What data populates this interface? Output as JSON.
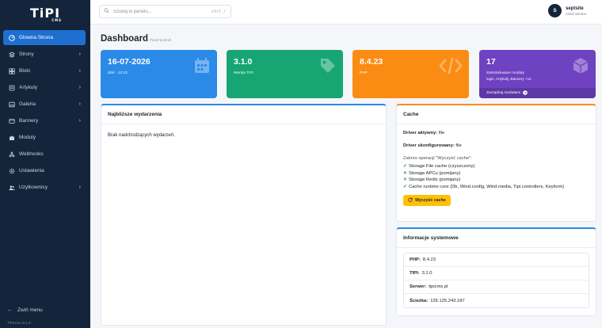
{
  "brand": {
    "logo": "TiPI",
    "logo_sub": "CMS",
    "version": "TiPIcms v3.1.0"
  },
  "sidebar": {
    "items": [
      {
        "label": "Glowna Strona",
        "icon": "dashboard-icon",
        "active": true,
        "chevron": false
      },
      {
        "label": "Strony",
        "icon": "layers-icon",
        "active": false,
        "chevron": true
      },
      {
        "label": "Bloki",
        "icon": "blocks-icon",
        "active": false,
        "chevron": true
      },
      {
        "label": "Artykuly",
        "icon": "article-icon",
        "active": false,
        "chevron": true
      },
      {
        "label": "Galeria",
        "icon": "image-icon",
        "active": false,
        "chevron": true
      },
      {
        "label": "Bannery",
        "icon": "banner-icon",
        "active": false,
        "chevron": true
      },
      {
        "label": "Moduly",
        "icon": "puzzle-icon",
        "active": false,
        "chevron": false
      },
      {
        "label": "Webhooks",
        "icon": "webhook-icon",
        "active": false,
        "chevron": false
      },
      {
        "label": "Ustawienia",
        "icon": "gear-icon",
        "active": false,
        "chevron": false
      },
      {
        "label": "Uzytkownicy",
        "icon": "users-icon",
        "active": false,
        "chevron": true
      }
    ],
    "collapse_label": "Zwiń menu"
  },
  "topbar": {
    "search_placeholder": "Szukaj w panelu...",
    "search_value": "",
    "shortcut": "ctrl /",
    "user": {
      "avatar_letter": "S",
      "name": "septsite",
      "role": "Administrator"
    }
  },
  "page": {
    "title": "Dashboard",
    "subtitle": "Panel kontroli"
  },
  "stats": [
    {
      "value": "16-07-2026",
      "label": "dziś · 12:43",
      "icon": "calendar-icon",
      "color": "#2b8ae8"
    },
    {
      "value": "3.1.0",
      "label": "Wersja TIPI",
      "icon": "tag-icon",
      "color": "#17a673"
    },
    {
      "value": "8.4.23",
      "label": "PHP",
      "icon": "code-icon",
      "color": "#fb8c13"
    },
    {
      "value": "17",
      "label": "Zainstalowane moduły",
      "label2": "login, Artykuly, Bannery +14",
      "footer": "Zarządzaj modułami",
      "icon": "cube-icon",
      "color": "#6f42c1"
    }
  ],
  "events": {
    "title": "Najbliższe wydarzenia",
    "empty": "Brak nadchodzących wydarzeń."
  },
  "cache": {
    "title": "Cache",
    "driver_active_label": "Driver aktywny:",
    "driver_active": "file",
    "driver_config_label": "Driver skonfigurowany:",
    "driver_config": "file",
    "ops_caption": "Zakres operacji \"Wyczyść cache\":",
    "ops": [
      {
        "status": "ok",
        "text": "Storage File cache (czyszczony)"
      },
      {
        "status": "skip",
        "text": "Storage APCu (pomijany)"
      },
      {
        "status": "skip",
        "text": "Storage Redis (pomijany)"
      },
      {
        "status": "ok",
        "text": "Cache runtime core (Db, Wind.config, Wind.media, Tipi.controllers, Keyform)"
      }
    ],
    "button": "Wyczyść cache"
  },
  "system": {
    "title": "Informacje systemowe",
    "rows": [
      {
        "key": "PHP:",
        "value": "8.4.23"
      },
      {
        "key": "TIPI:",
        "value": "3.1.0"
      },
      {
        "key": "Serwer:",
        "value": "tipicms.pl"
      },
      {
        "key": "Ścieżka:",
        "value": "135.125.243.187"
      }
    ]
  },
  "colors": {
    "sidebar_bg": "#14243a",
    "accent": "#1f6fd1",
    "warning": "#ffc107"
  }
}
